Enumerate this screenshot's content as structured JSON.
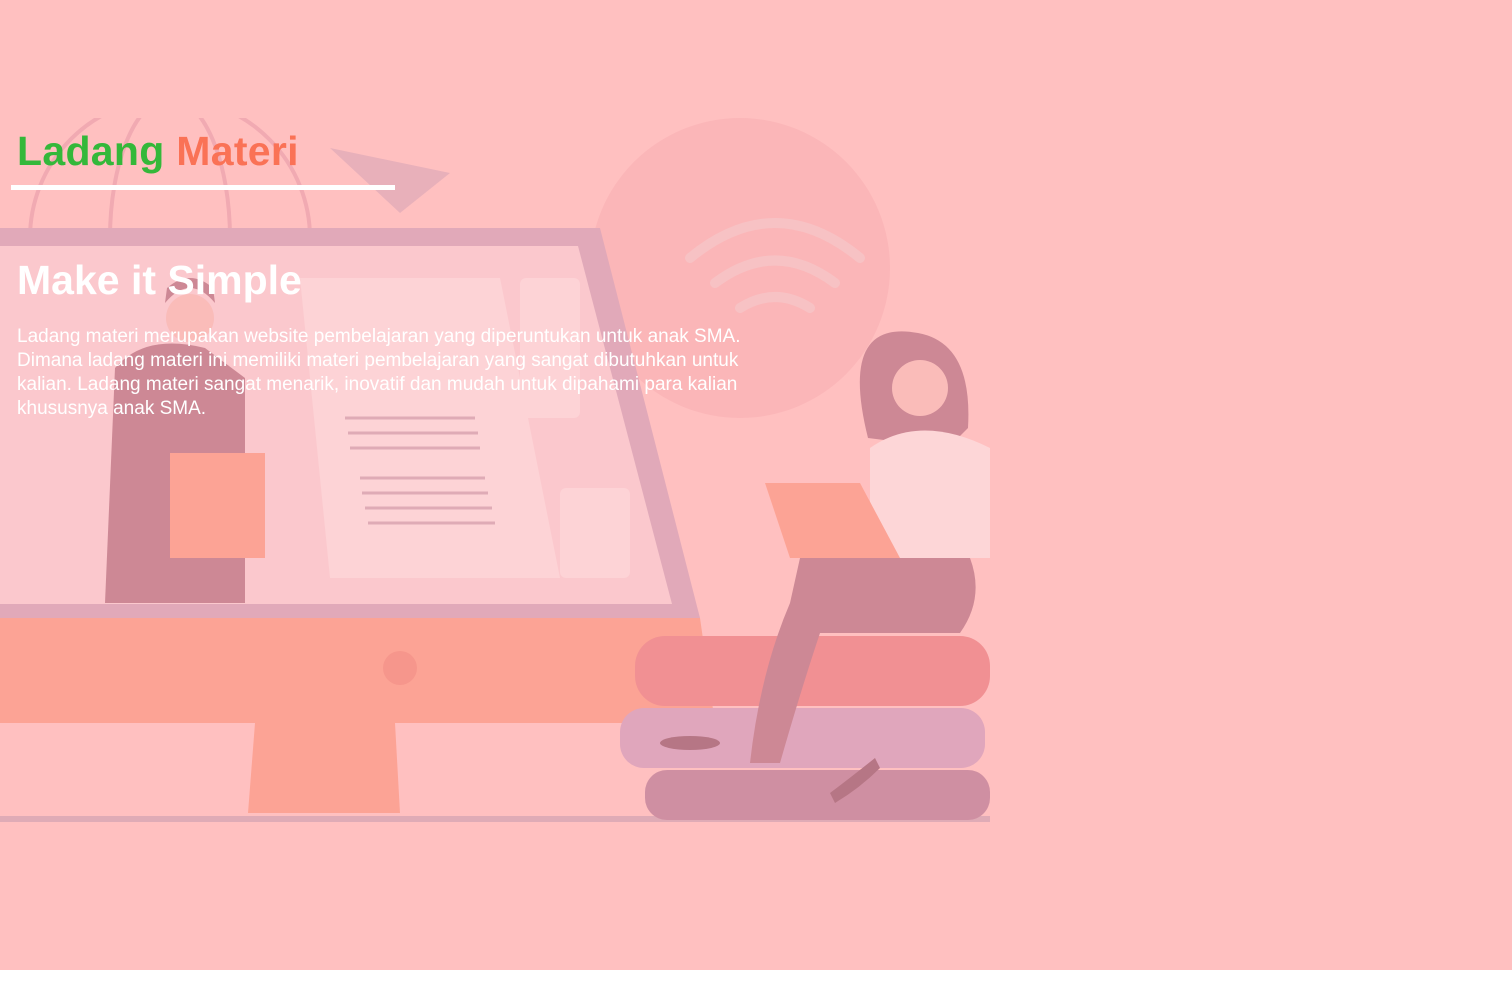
{
  "brand": {
    "part_1": "Ladang",
    "part_2": "Materi",
    "colors": {
      "part_1": "#34b83a",
      "part_2": "#fa7256"
    }
  },
  "hero": {
    "headline": "Make it Simple",
    "description": "Ladang materi merupakan website pembelajaran yang diperuntukan untuk anak SMA. Dimana ladang materi ini memiliki materi pembelajaran yang sangat dibutuhkan untuk kalian. Ladang materi sangat menarik, inovatif dan mudah untuk dipahami para kalian khususnya anak SMA.",
    "illustration": "illustration of a man holding a folder inside a desktop monitor and a woman with a laptop sitting on a stack of books"
  },
  "colors": {
    "background": "#ffc0c0",
    "text": "#ffffff"
  }
}
